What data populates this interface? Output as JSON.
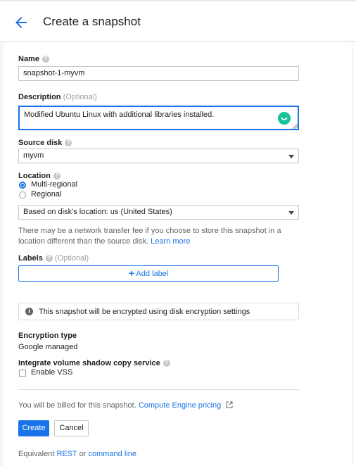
{
  "header": {
    "title": "Create a snapshot"
  },
  "name_field": {
    "label": "Name",
    "value": "snapshot-1-myvm"
  },
  "description_field": {
    "label": "Description",
    "optional": "(Optional)",
    "value": "Modified Ubuntu Linux with additional libraries installed."
  },
  "source_disk": {
    "label": "Source disk",
    "value": "myvm"
  },
  "location": {
    "label": "Location",
    "options": [
      "Multi-regional",
      "Regional"
    ],
    "selected": "Multi-regional",
    "dropdown_value": "Based on disk's location: us (United States)",
    "note_line1": "There may be a network transfer fee if you choose to store this snapshot in a",
    "note_line2": "location different than the source disk.",
    "learn_more": "Learn more"
  },
  "labels": {
    "label": "Labels",
    "optional": "(Optional)",
    "add_label": "Add label"
  },
  "encryption": {
    "info": "This snapshot will be encrypted using disk encryption settings",
    "type_label": "Encryption type",
    "type_value": "Google managed"
  },
  "vss": {
    "label": "Integrate volume shadow copy service",
    "checkbox_label": "Enable VSS",
    "checked": false
  },
  "billing": {
    "text": "You will be billed for this snapshot.",
    "link": "Compute Engine pricing"
  },
  "actions": {
    "create": "Create",
    "cancel": "Cancel"
  },
  "footer": {
    "prefix": "Equivalent",
    "rest": "REST",
    "or": "or",
    "cmd": "command line"
  },
  "colors": {
    "accent": "#1a73e8",
    "grammarly": "#15c39a"
  }
}
